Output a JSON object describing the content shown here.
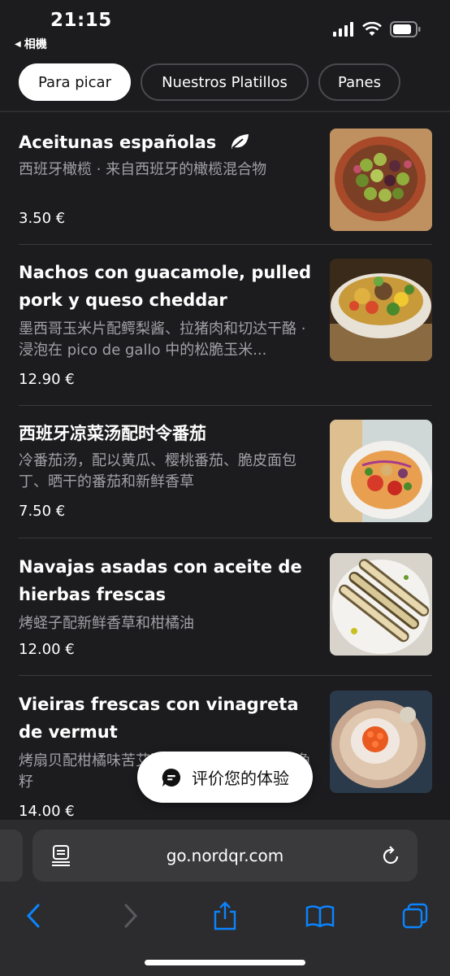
{
  "status_bar": {
    "time": "21:15",
    "back_label": "相機",
    "icons": [
      "signal-icon",
      "wifi-icon",
      "battery-icon"
    ]
  },
  "tabs": [
    {
      "label": "Para picar",
      "active": true
    },
    {
      "label": "Nuestros Platillos",
      "active": false
    },
    {
      "label": "Panes",
      "active": false
    }
  ],
  "items": [
    {
      "title": "Aceitunas españolas",
      "tag_icon": "leaf-icon",
      "description": "西班牙橄榄 · 来自西班牙的橄榄混合物",
      "price": "3.50 €"
    },
    {
      "title": "Nachos con guacamole, pulled pork y queso cheddar",
      "description": "墨西哥玉米片配鳄梨酱、拉猪肉和切达干酪 · 浸泡在 pico de gallo 中的松脆玉米...",
      "price": "12.90 €"
    },
    {
      "title": "西班牙凉菜汤配时令番茄",
      "description": "冷番茄汤，配以黄瓜、樱桃番茄、脆皮面包丁、晒干的番茄和新鲜香草",
      "price": "7.50 €"
    },
    {
      "title": "Navajas asadas con aceite de hierbas frescas",
      "description": "烤蛏子配新鲜香草和柑橘油",
      "price": "12.00 €"
    },
    {
      "title": "Vieiras frescas con vinagreta de vermut",
      "description": "烤扇贝配柑橘味苦艾酒醋汁、油炸香草和鲑鱼籽",
      "price": "14.00 €"
    }
  ],
  "feedback": {
    "label": "评价您的体验",
    "icon": "chat-bubble-icon"
  },
  "browser": {
    "url": "go.nordqr.com",
    "reader_icon": "reader-icon",
    "reload_icon": "reload-icon",
    "toolbar_icons": [
      "back-icon",
      "forward-icon",
      "share-icon",
      "bookmarks-icon",
      "tabs-icon"
    ]
  },
  "colors": {
    "background": "#1c1c1e",
    "accent": "#0a84ff",
    "muted_text": "#a1a1a6"
  }
}
